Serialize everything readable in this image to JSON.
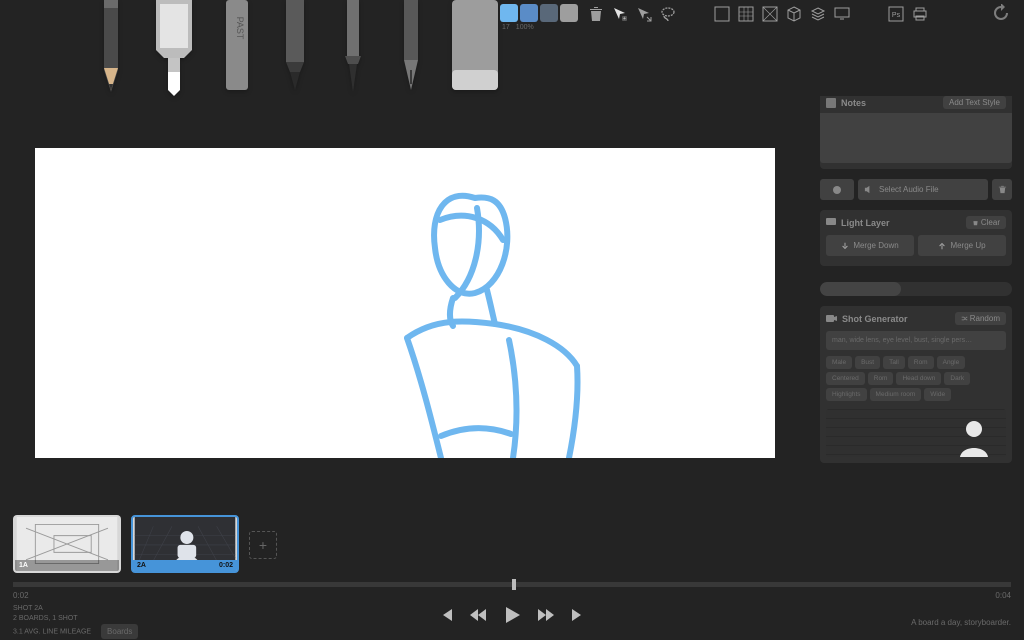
{
  "swatches": {
    "colors": [
      "#6fb7ef",
      "#5a8cc7",
      "#596879",
      "#9e9e9e"
    ],
    "size_label": "17",
    "opacity_label": "100%"
  },
  "notes": {
    "title": "Notes",
    "new_text_style": "Add Text Style"
  },
  "audio": {
    "select_label": "Select Audio File"
  },
  "light_layer": {
    "title": "Light Layer",
    "clear": "Clear",
    "merge_down": "Merge Down",
    "merge_up": "Merge Up"
  },
  "shot_generator": {
    "title": "Shot Generator",
    "random": "Random",
    "prompt": "man, wide lens, eye level, bust, single pers…",
    "chips": [
      "Male",
      "Bust",
      "Tall",
      "Rom",
      "Angle",
      "Centered",
      "Rom",
      "Head down",
      "Dark",
      "Highlights",
      "Medium room",
      "Wide"
    ]
  },
  "thumbnails": [
    {
      "label": "1A",
      "dur": ""
    },
    {
      "label": "2A",
      "dur": "0:02"
    }
  ],
  "timeline": {
    "left_time": "0:02",
    "right_time": "0:04"
  },
  "status": {
    "shot": "SHOT 2A",
    "boards": "2 BOARDS, 1 SHOT",
    "avg": "3.1 AVG. LINE MILEAGE",
    "toggle": "Boards",
    "tagline": "A board a day, storyboarder."
  }
}
